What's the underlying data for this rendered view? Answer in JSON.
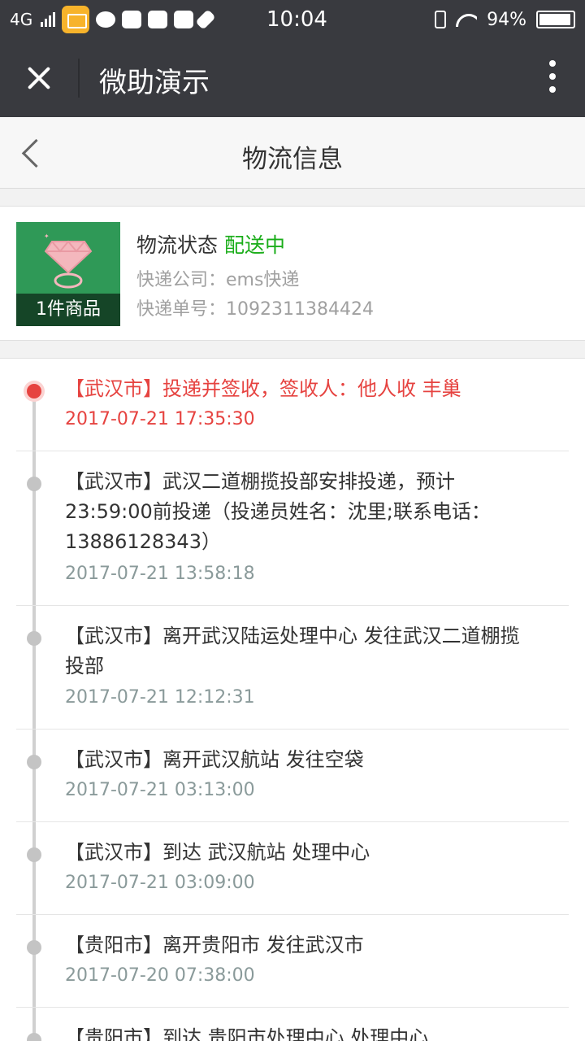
{
  "status_bar": {
    "network": "4G",
    "time": "10:04",
    "battery": "94%",
    "battery_level": 0.94,
    "icons": [
      "signal-icon",
      "mail-app-icon",
      "chat-bubble-icon",
      "bag-icon",
      "bag-icon",
      "camera-icon",
      "brush-icon",
      "vibrate-icon",
      "wifi-icon",
      "battery-icon"
    ]
  },
  "titlebar": {
    "title": "微助演示"
  },
  "page": {
    "title": "物流信息"
  },
  "order": {
    "status_label": "物流状态",
    "status_value": "配送中",
    "company": "快递公司：ems快递",
    "tracking": "快递单号：1092311384424",
    "item_count": "1件商品"
  },
  "colors": {
    "bar_bg": "#393a3f",
    "success_green": "#1aad19",
    "active_red": "#e64340",
    "thumb_green": "#2f9957"
  },
  "timeline": [
    {
      "text": "【武汉市】投递并签收，签收人：他人收 丰巢",
      "time": "2017-07-21 17:35:30",
      "active": true
    },
    {
      "text": "【武汉市】武汉二道棚揽投部安排投递，预计23:59:00前投递（投递员姓名：沈里;联系电话：13886128343）",
      "time": "2017-07-21 13:58:18"
    },
    {
      "text": "【武汉市】离开武汉陆运处理中心 发往武汉二道棚揽投部",
      "time": "2017-07-21 12:12:31"
    },
    {
      "text": "【武汉市】离开武汉航站 发往空袋",
      "time": "2017-07-21 03:13:00"
    },
    {
      "text": "【武汉市】到达 武汉航站 处理中心",
      "time": "2017-07-21 03:09:00"
    },
    {
      "text": "【贵阳市】离开贵阳市 发往武汉市",
      "time": "2017-07-20 07:38:00"
    },
    {
      "text": "【贵阳市】到达 贵阳市处理中心 处理中心",
      "time": ""
    }
  ]
}
